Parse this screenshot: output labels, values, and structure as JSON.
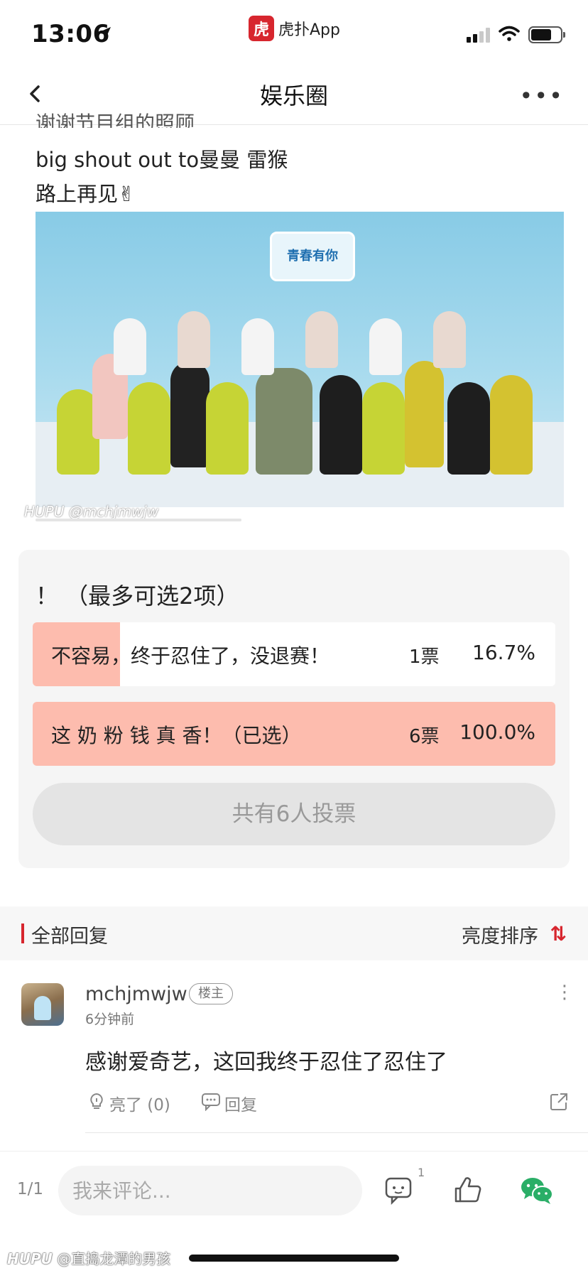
{
  "status_bar": {
    "time": "13:06",
    "app_name": "虎扑App",
    "app_logo_char": "虎",
    "signal_icon": "signal-icon",
    "wifi_icon": "wifi-icon",
    "battery_icon": "battery-icon"
  },
  "nav": {
    "title": "娱乐圈",
    "back_icon": "back-chevron-icon",
    "more_label": "•••"
  },
  "post": {
    "cut_line": "谢谢节目组的照顾",
    "lines": [
      "big shout out to曼曼 雷猴",
      "路上再见✌"
    ],
    "image_banner": "青春有你",
    "image_watermark": "HUPU @mchjmwjw"
  },
  "poll": {
    "title": "！ （最多可选2项）",
    "options": [
      {
        "text": "不容易，终于忍住了，没退赛！",
        "votes": "1票",
        "percent": "16.7%",
        "fill": 0.167
      },
      {
        "text": "这 奶 粉 钱 真 香！（已选）",
        "votes": "6票",
        "percent": "100.0%",
        "fill": 1.0
      }
    ],
    "total": "共有6人投票"
  },
  "replies_header": {
    "title": "全部回复",
    "sort_label": "亮度排序",
    "sort_icon": "⇅"
  },
  "reply": {
    "username": "mchjmwjw",
    "badge": "楼主",
    "time": "6分钟前",
    "content": "感谢爱奇艺，这回我终于忍住了忍住了",
    "light_label": "亮了 (0)",
    "reply_label": "回复",
    "menu_icon": "more-vertical-icon"
  },
  "bottom_bar": {
    "page_indicator": "1/1",
    "comment_placeholder": "我来评论...",
    "comment_count": "1"
  },
  "footer": {
    "watermark_brand": "HUPU",
    "watermark_user": "@直捣龙潭的男孩"
  },
  "colors": {
    "accent": "#d7262e",
    "poll_fill": "#fdbcae",
    "wechat": "#2aae67"
  }
}
